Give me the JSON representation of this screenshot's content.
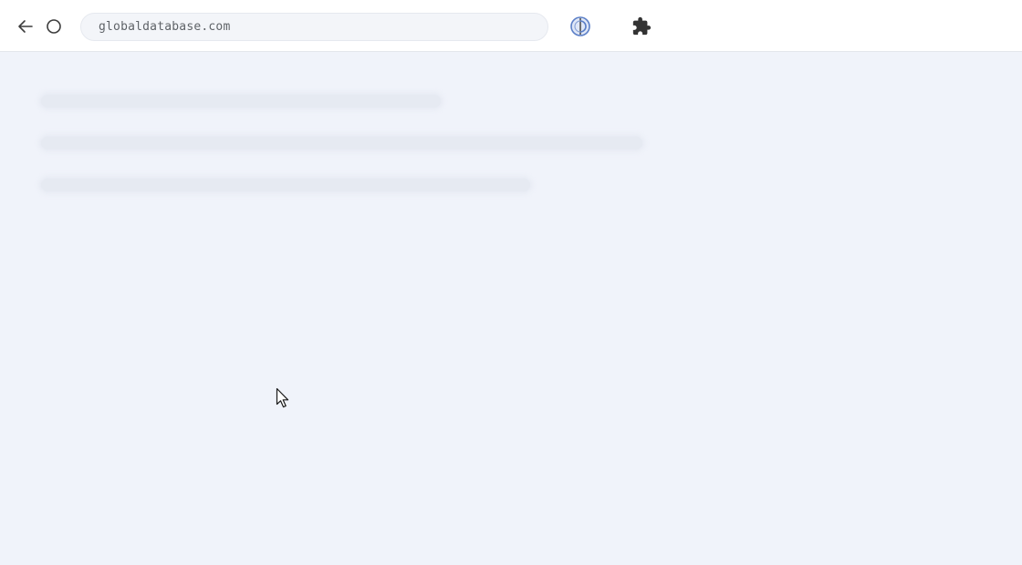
{
  "browser": {
    "url": "globaldatabase.com",
    "icons": {
      "back": "back-arrow-icon",
      "reload": "reload-icon",
      "extension_logo": "extension-logo-icon",
      "extensions": "puzzle-piece-icon",
      "cursor": "mouse-cursor-icon"
    },
    "colors": {
      "toolbar_bg": "#ffffff",
      "page_bg": "#f0f3fa",
      "skeleton": "#e6eaf2",
      "icon": "#3c3c3c",
      "logo_accent": "#5b7fc7"
    }
  },
  "page": {
    "state": "loading",
    "skeleton_line_count": 3
  }
}
